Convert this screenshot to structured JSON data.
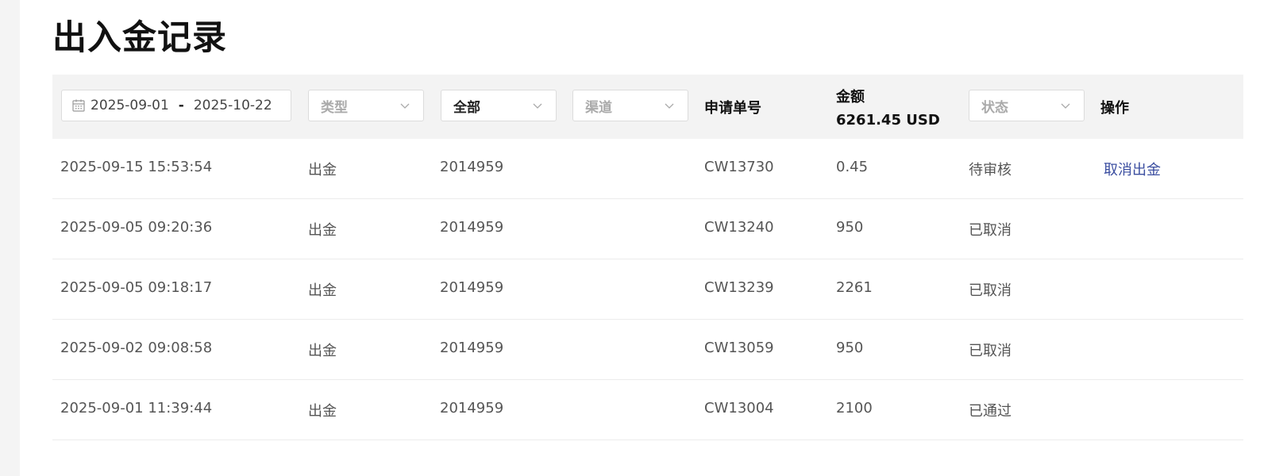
{
  "page": {
    "title": "出入金记录"
  },
  "filters": {
    "date_start": "2025-09-01",
    "date_separator": "-",
    "date_end": "2025-10-22",
    "type_placeholder": "类型",
    "scope_value": "全部",
    "channel_placeholder": "渠道",
    "status_placeholder": "状态"
  },
  "columns": {
    "order_no": "申请单号",
    "amount": "金额",
    "amount_total": "6261.45 USD",
    "action": "操作"
  },
  "records": [
    {
      "time": "2025-09-15 15:53:54",
      "type": "出金",
      "account": "2014959",
      "order_no": "CW13730",
      "amount": "0.45",
      "status": "待审核",
      "action": "取消出金"
    },
    {
      "time": "2025-09-05 09:20:36",
      "type": "出金",
      "account": "2014959",
      "order_no": "CW13240",
      "amount": "950",
      "status": "已取消",
      "action": ""
    },
    {
      "time": "2025-09-05 09:18:17",
      "type": "出金",
      "account": "2014959",
      "order_no": "CW13239",
      "amount": "2261",
      "status": "已取消",
      "action": ""
    },
    {
      "time": "2025-09-02 09:08:58",
      "type": "出金",
      "account": "2014959",
      "order_no": "CW13059",
      "amount": "950",
      "status": "已取消",
      "action": ""
    },
    {
      "time": "2025-09-01 11:39:44",
      "type": "出金",
      "account": "2014959",
      "order_no": "CW13004",
      "amount": "2100",
      "status": "已通过",
      "action": ""
    }
  ],
  "icons": {
    "date": "calendar-icon",
    "dropdown": "chevron-down-icon"
  },
  "colors": {
    "link": "#3b4ea0",
    "header_bg": "#f3f3f3"
  }
}
